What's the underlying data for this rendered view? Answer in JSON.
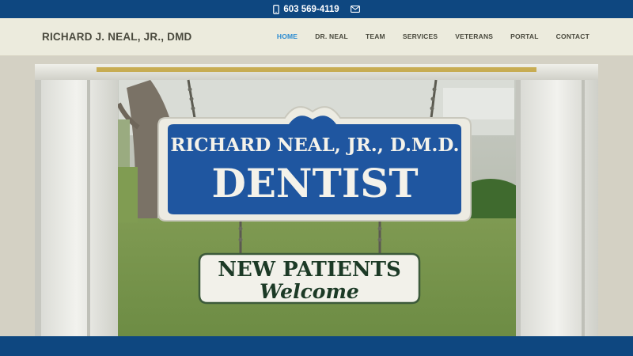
{
  "topbar": {
    "phone": "603 569-4119",
    "phone_icon": "phone-icon",
    "mail_icon": "envelope-icon"
  },
  "header": {
    "brand": "RICHARD J. NEAL, JR., DMD",
    "nav": [
      {
        "label": "HOME",
        "active": true
      },
      {
        "label": "DR. NEAL",
        "active": false
      },
      {
        "label": "TEAM",
        "active": false
      },
      {
        "label": "SERVICES",
        "active": false
      },
      {
        "label": "VETERANS",
        "active": false
      },
      {
        "label": "PORTAL",
        "active": false
      },
      {
        "label": "CONTACT",
        "active": false
      }
    ]
  },
  "hero": {
    "sign_line1": "RICHARD NEAL, JR., D.M.D.",
    "sign_line2": "DENTIST",
    "subsign_line1": "NEW PATIENTS",
    "subsign_line2": "Welcome"
  },
  "colors": {
    "brand_blue": "#0e4780",
    "nav_active": "#2a8bd1",
    "sign_blue": "#1f56a0"
  }
}
